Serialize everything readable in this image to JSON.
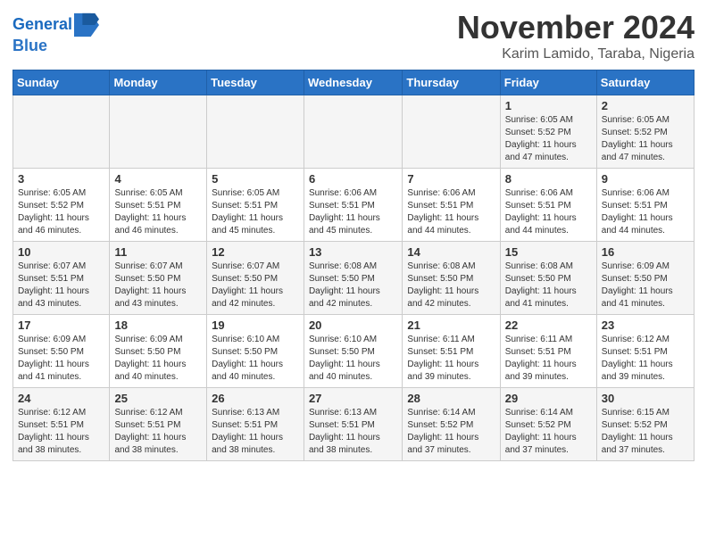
{
  "header": {
    "logo_line1": "General",
    "logo_line2": "Blue",
    "title": "November 2024",
    "subtitle": "Karim Lamido, Taraba, Nigeria"
  },
  "calendar": {
    "days_of_week": [
      "Sunday",
      "Monday",
      "Tuesday",
      "Wednesday",
      "Thursday",
      "Friday",
      "Saturday"
    ],
    "weeks": [
      [
        {
          "day": "",
          "info": ""
        },
        {
          "day": "",
          "info": ""
        },
        {
          "day": "",
          "info": ""
        },
        {
          "day": "",
          "info": ""
        },
        {
          "day": "",
          "info": ""
        },
        {
          "day": "1",
          "info": "Sunrise: 6:05 AM\nSunset: 5:52 PM\nDaylight: 11 hours\nand 47 minutes."
        },
        {
          "day": "2",
          "info": "Sunrise: 6:05 AM\nSunset: 5:52 PM\nDaylight: 11 hours\nand 47 minutes."
        }
      ],
      [
        {
          "day": "3",
          "info": "Sunrise: 6:05 AM\nSunset: 5:52 PM\nDaylight: 11 hours\nand 46 minutes."
        },
        {
          "day": "4",
          "info": "Sunrise: 6:05 AM\nSunset: 5:51 PM\nDaylight: 11 hours\nand 46 minutes."
        },
        {
          "day": "5",
          "info": "Sunrise: 6:05 AM\nSunset: 5:51 PM\nDaylight: 11 hours\nand 45 minutes."
        },
        {
          "day": "6",
          "info": "Sunrise: 6:06 AM\nSunset: 5:51 PM\nDaylight: 11 hours\nand 45 minutes."
        },
        {
          "day": "7",
          "info": "Sunrise: 6:06 AM\nSunset: 5:51 PM\nDaylight: 11 hours\nand 44 minutes."
        },
        {
          "day": "8",
          "info": "Sunrise: 6:06 AM\nSunset: 5:51 PM\nDaylight: 11 hours\nand 44 minutes."
        },
        {
          "day": "9",
          "info": "Sunrise: 6:06 AM\nSunset: 5:51 PM\nDaylight: 11 hours\nand 44 minutes."
        }
      ],
      [
        {
          "day": "10",
          "info": "Sunrise: 6:07 AM\nSunset: 5:51 PM\nDaylight: 11 hours\nand 43 minutes."
        },
        {
          "day": "11",
          "info": "Sunrise: 6:07 AM\nSunset: 5:50 PM\nDaylight: 11 hours\nand 43 minutes."
        },
        {
          "day": "12",
          "info": "Sunrise: 6:07 AM\nSunset: 5:50 PM\nDaylight: 11 hours\nand 42 minutes."
        },
        {
          "day": "13",
          "info": "Sunrise: 6:08 AM\nSunset: 5:50 PM\nDaylight: 11 hours\nand 42 minutes."
        },
        {
          "day": "14",
          "info": "Sunrise: 6:08 AM\nSunset: 5:50 PM\nDaylight: 11 hours\nand 42 minutes."
        },
        {
          "day": "15",
          "info": "Sunrise: 6:08 AM\nSunset: 5:50 PM\nDaylight: 11 hours\nand 41 minutes."
        },
        {
          "day": "16",
          "info": "Sunrise: 6:09 AM\nSunset: 5:50 PM\nDaylight: 11 hours\nand 41 minutes."
        }
      ],
      [
        {
          "day": "17",
          "info": "Sunrise: 6:09 AM\nSunset: 5:50 PM\nDaylight: 11 hours\nand 41 minutes."
        },
        {
          "day": "18",
          "info": "Sunrise: 6:09 AM\nSunset: 5:50 PM\nDaylight: 11 hours\nand 40 minutes."
        },
        {
          "day": "19",
          "info": "Sunrise: 6:10 AM\nSunset: 5:50 PM\nDaylight: 11 hours\nand 40 minutes."
        },
        {
          "day": "20",
          "info": "Sunrise: 6:10 AM\nSunset: 5:50 PM\nDaylight: 11 hours\nand 40 minutes."
        },
        {
          "day": "21",
          "info": "Sunrise: 6:11 AM\nSunset: 5:51 PM\nDaylight: 11 hours\nand 39 minutes."
        },
        {
          "day": "22",
          "info": "Sunrise: 6:11 AM\nSunset: 5:51 PM\nDaylight: 11 hours\nand 39 minutes."
        },
        {
          "day": "23",
          "info": "Sunrise: 6:12 AM\nSunset: 5:51 PM\nDaylight: 11 hours\nand 39 minutes."
        }
      ],
      [
        {
          "day": "24",
          "info": "Sunrise: 6:12 AM\nSunset: 5:51 PM\nDaylight: 11 hours\nand 38 minutes."
        },
        {
          "day": "25",
          "info": "Sunrise: 6:12 AM\nSunset: 5:51 PM\nDaylight: 11 hours\nand 38 minutes."
        },
        {
          "day": "26",
          "info": "Sunrise: 6:13 AM\nSunset: 5:51 PM\nDaylight: 11 hours\nand 38 minutes."
        },
        {
          "day": "27",
          "info": "Sunrise: 6:13 AM\nSunset: 5:51 PM\nDaylight: 11 hours\nand 38 minutes."
        },
        {
          "day": "28",
          "info": "Sunrise: 6:14 AM\nSunset: 5:52 PM\nDaylight: 11 hours\nand 37 minutes."
        },
        {
          "day": "29",
          "info": "Sunrise: 6:14 AM\nSunset: 5:52 PM\nDaylight: 11 hours\nand 37 minutes."
        },
        {
          "day": "30",
          "info": "Sunrise: 6:15 AM\nSunset: 5:52 PM\nDaylight: 11 hours\nand 37 minutes."
        }
      ]
    ]
  }
}
